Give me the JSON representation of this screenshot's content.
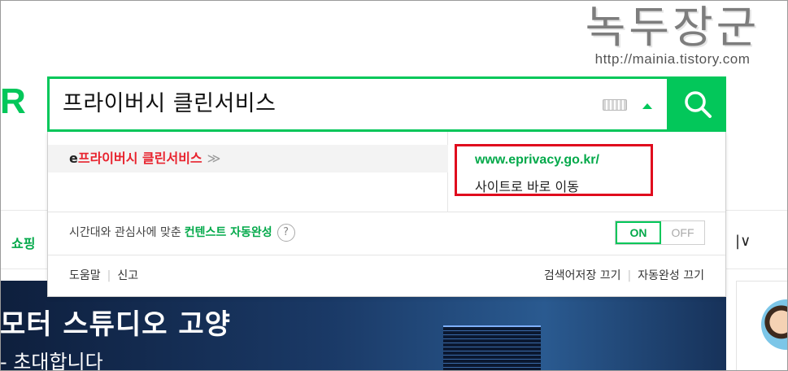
{
  "logo": {
    "fragment": "R"
  },
  "watermark": {
    "title": "녹두장군",
    "url": "http://mainia.tistory.com"
  },
  "search": {
    "query": "프라이버시 클린서비스"
  },
  "suggestion": {
    "prefix": "e",
    "term": "프라이버시 클린서비스",
    "chevron": "≫"
  },
  "site_link": {
    "url": "www.eprivacy.go.kr/",
    "go_label": "사이트로 바로 이동"
  },
  "context": {
    "text": "시간대와 관심사에 맞춘",
    "link": "컨텐스트 자동완성",
    "help_symbol": "?"
  },
  "toggle": {
    "on": "ON",
    "off": "OFF"
  },
  "footer": {
    "help": "도움말",
    "report": "신고",
    "history_off": "검색어저장 끄기",
    "autocomplete_off": "자동완성 끄기"
  },
  "background": {
    "shopping_tab": "쇼핑",
    "menu_caret": "|∨",
    "banner_title": "모터 스튜디오 고양",
    "banner_sub": "- 초대합니다"
  },
  "colors": {
    "brand_green": "#03c75a",
    "highlight_red": "#e00a1d",
    "term_red": "#e8232e"
  }
}
